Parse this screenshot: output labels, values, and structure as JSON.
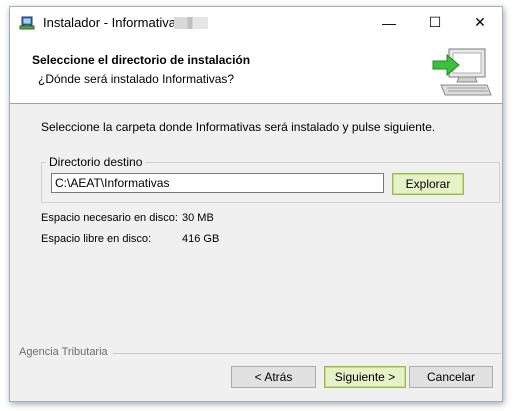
{
  "window": {
    "title": "Instalador - Informativas",
    "controls": {
      "minimize": "—",
      "maximize": "☐",
      "close": "✕"
    }
  },
  "header": {
    "title": "Seleccione el directorio de instalación",
    "subtitle": "¿Dónde será instalado Informativas?"
  },
  "body": {
    "instruction": "Seleccione la carpeta donde Informativas será instalado y pulse siguiente.",
    "destination": {
      "label": "Directorio destino",
      "value": "C:\\AEAT\\Informativas",
      "browse_label": "Explorar"
    },
    "space_required_label": "Espacio necesario en disco:",
    "space_required_value": "30 MB",
    "space_free_label": "Espacio libre en disco:",
    "space_free_value": "416 GB"
  },
  "footer": {
    "brand": "Agencia Tributaria",
    "back_label": "< Atrás",
    "next_label": "Siguiente >",
    "cancel_label": "Cancelar"
  },
  "colors": {
    "accent_green": "#3fbf3f",
    "focus_button": "#e5f1c6"
  },
  "icons": [
    "installer-app-icon",
    "computer-install-graphic"
  ]
}
